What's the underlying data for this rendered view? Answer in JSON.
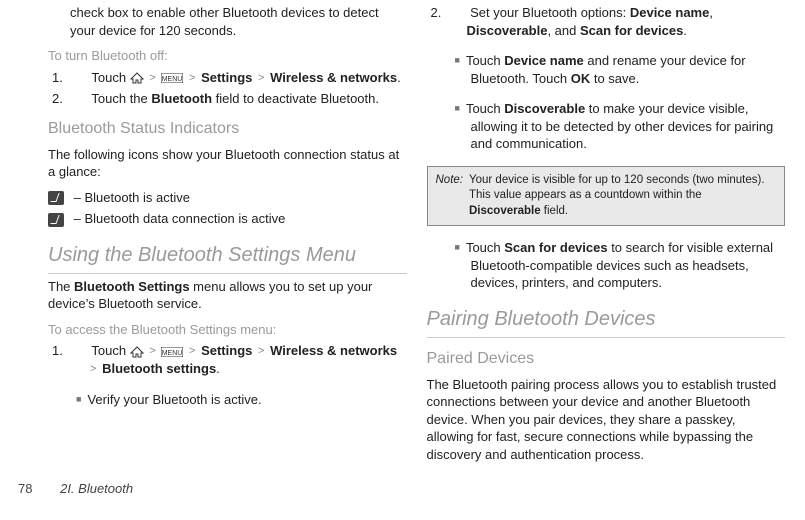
{
  "left": {
    "top_frag": "check box to enable other Bluetooth devices to detect your device for 120 seconds.",
    "off_head": "To turn Bluetooth off:",
    "off_step1_pre": "Touch ",
    "off_step1_settings": "Settings",
    "off_step1_wireless": "Wireless & networks",
    "off_step2_a": "Touch the ",
    "off_step2_b": "Bluetooth",
    "off_step2_c": " field to deactivate Bluetooth.",
    "status_head": "Bluetooth Status Indicators",
    "status_intro": "The following icons show your Bluetooth connection status at a glance:",
    "status_1": " – Bluetooth is active",
    "status_2": " – Bluetooth data connection is active",
    "using_head": "Using the Bluetooth Settings Menu",
    "using_intro_a": "The ",
    "using_intro_b": "Bluetooth Settings",
    "using_intro_c": " menu allows you to set up your device’s Bluetooth service.",
    "access_head": "To access the Bluetooth Settings menu:",
    "access_step1_pre": "Touch ",
    "access_step1_settings": "Settings",
    "access_step1_wireless": "Wireless & networks",
    "access_step1_bt": "Bluetooth settings",
    "access_verify": "Verify your Bluetooth is active."
  },
  "right": {
    "step2_a": "Set your Bluetooth options: ",
    "step2_b": "Device name",
    "step2_c": ", ",
    "step2_d": "Discoverable",
    "step2_e": ", and ",
    "step2_f": "Scan for devices",
    "devname_a": "Touch ",
    "devname_b": "Device name",
    "devname_c": " and rename your device for Bluetooth. Touch ",
    "devname_d": "OK",
    "devname_e": " to save.",
    "disc_a": "Touch ",
    "disc_b": "Discoverable",
    "disc_c": " to make your device visible, allowing it to be detected by other devices for pairing and communication.",
    "note_label": "Note:",
    "note_a": "Your device is visible for up to 120 seconds (two minutes). This value appears as a countdown within the ",
    "note_b": "Discoverable",
    "note_c": " field.",
    "scan_a": "Touch ",
    "scan_b": "Scan for devices",
    "scan_c": " to search for visible external Bluetooth-compatible devices such as headsets, devices, printers, and computers.",
    "pair_head": "Pairing Bluetooth Devices",
    "paired_sub": "Paired Devices",
    "paired_body": "The Bluetooth pairing process allows you to establish trusted connections between your device and another Bluetooth device. When you pair devices, they share a passkey, allowing for fast, secure connections while bypassing the discovery and authentication process."
  },
  "footer": {
    "page": "78",
    "section": "2I. Bluetooth"
  },
  "nums": {
    "n1": "1.",
    "n2": "2."
  },
  "period": "."
}
